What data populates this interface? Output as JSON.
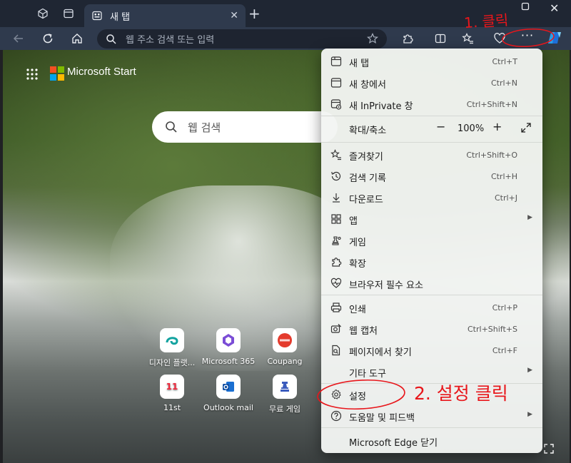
{
  "browser": {
    "tab_title": "새 탭",
    "address_placeholder": "웹 주소 검색 또는 입력"
  },
  "page": {
    "brand": "Microsoft Start",
    "search_placeholder": "웹 검색",
    "quick_links": [
      {
        "label": "디자인 플랫...",
        "tile_color": "#13a3a0"
      },
      {
        "label": "Microsoft 365",
        "tile_color": "#7b4dd6"
      },
      {
        "label": "Coupang",
        "tile_color": "#e43b2d"
      },
      {
        "label": "11st",
        "tile_color": "#f0283c",
        "tile_text": "11"
      },
      {
        "label": "Outlook mail",
        "tile_color": "#1a6fd1"
      },
      {
        "label": "무료 게임",
        "tile_color": "#3a5bbd"
      }
    ]
  },
  "menu": {
    "items": [
      {
        "id": "new-tab",
        "icon": "new-tab-icon",
        "label": "새 탭",
        "shortcut": "Ctrl+T"
      },
      {
        "id": "new-window",
        "icon": "new-window-icon",
        "label": "새 창에서",
        "shortcut": "Ctrl+N"
      },
      {
        "id": "inprivate",
        "icon": "inprivate-icon",
        "label": "새 InPrivate 창",
        "shortcut": "Ctrl+Shift+N"
      },
      {
        "id": "zoom",
        "icon": "",
        "label": "확대/축소",
        "zoom_value": "100%"
      },
      {
        "id": "favorites",
        "icon": "favorites-icon",
        "label": "즐겨찾기",
        "shortcut": "Ctrl+Shift+O"
      },
      {
        "id": "history",
        "icon": "history-icon",
        "label": "검색 기록",
        "shortcut": "Ctrl+H"
      },
      {
        "id": "downloads",
        "icon": "download-icon",
        "label": "다운로드",
        "shortcut": "Ctrl+J"
      },
      {
        "id": "apps",
        "icon": "apps-icon",
        "label": "앱",
        "submenu": true
      },
      {
        "id": "games",
        "icon": "games-icon",
        "label": "게임"
      },
      {
        "id": "extensions",
        "icon": "extensions-icon",
        "label": "확장"
      },
      {
        "id": "essentials",
        "icon": "browser-essentials-icon",
        "label": "브라우저 필수 요소"
      },
      {
        "id": "print",
        "icon": "print-icon",
        "label": "인쇄",
        "shortcut": "Ctrl+P"
      },
      {
        "id": "web-capture",
        "icon": "web-capture-icon",
        "label": "웹 캡처",
        "shortcut": "Ctrl+Shift+S"
      },
      {
        "id": "find",
        "icon": "find-icon",
        "label": "페이지에서 찾기",
        "shortcut": "Ctrl+F"
      },
      {
        "id": "more-tools",
        "icon": "",
        "label": "기타 도구",
        "submenu": true
      },
      {
        "id": "settings",
        "icon": "gear-icon",
        "label": "설정"
      },
      {
        "id": "help",
        "icon": "help-icon",
        "label": "도움말 및 피드백",
        "submenu": true
      },
      {
        "id": "close-edge",
        "icon": "",
        "label": "Microsoft Edge 닫기"
      }
    ]
  },
  "annotations": {
    "step1": "1. 클릭",
    "step2": "2. 설정 클릭",
    "color": "#e8161b"
  }
}
